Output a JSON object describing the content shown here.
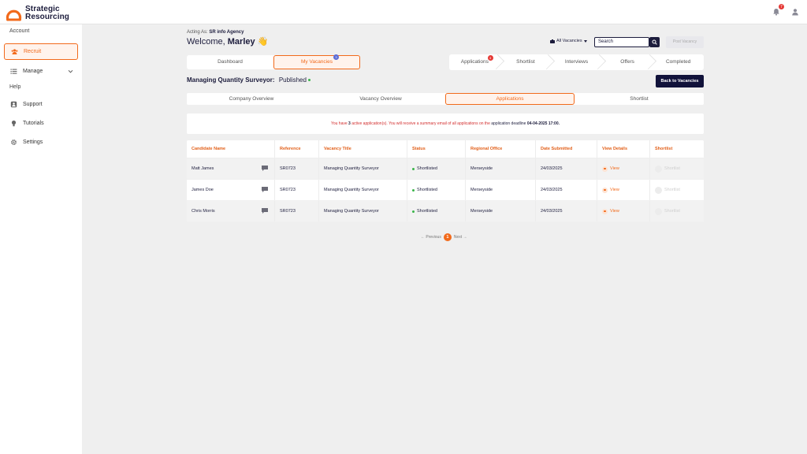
{
  "brand": {
    "line1": "Strategic",
    "line2": "Resourcing",
    "accent": "#f26a1b",
    "navy": "#1c1c3c"
  },
  "header": {
    "notification_count": "7",
    "icons": [
      "bell-icon",
      "user-icon"
    ]
  },
  "sidebar": {
    "section_account": "Account",
    "section_help": "Help",
    "items": [
      {
        "label": "Recruit",
        "icon": "recruit-icon",
        "active": true
      },
      {
        "label": "Manage",
        "icon": "list-icon"
      },
      {
        "label": "Support",
        "icon": "support-icon"
      },
      {
        "label": "Tutorials",
        "icon": "bulb-icon"
      },
      {
        "label": "Settings",
        "icon": "gear-icon"
      }
    ]
  },
  "page": {
    "acting_as_label": "Acting As:",
    "acting_as_value": "SR info Agency",
    "welcome_prefix": "Welcome,",
    "welcome_name": "Marley",
    "welcome_emoji": "👋",
    "all_vacancies": "All Vacancies",
    "search_placeholder": "Search",
    "post_vacancy": "Post Vacancy",
    "tabs": [
      {
        "label": "Dashboard"
      },
      {
        "label": "My Vacancies",
        "badge": "3"
      }
    ],
    "stages": [
      {
        "label": "Applications",
        "badge": "3"
      },
      {
        "label": "Shortlist"
      },
      {
        "label": "Interviews"
      },
      {
        "label": "Offers"
      },
      {
        "label": "Completed"
      }
    ],
    "vacancy_title": "Managing Quantity Surveyor:",
    "vacancy_status": "Published",
    "back_button": "Back to Vacancies",
    "subtabs": [
      "Company Overview",
      "Vacancy Overview",
      "Applications",
      "Shortlist"
    ],
    "notice": {
      "pre": "You have",
      "count": "3",
      "mid": "active application(s). You will receive a summary email of all applications on the",
      "deadline_label": "application deadline",
      "deadline_value": "04-04-2025 17:00."
    }
  },
  "table": {
    "headers": [
      "Candidate Name",
      "Reference",
      "Vacancy Title",
      "Status",
      "Regional Office",
      "Date Submitted",
      "View Details",
      "Shortlist"
    ],
    "rows": [
      {
        "name": "Matt James",
        "ref": "SR0723",
        "title": "Managing Quantity Surveyor",
        "status": "Shortlisted",
        "office": "Merseyside",
        "date": "24/03/2025",
        "view": "View",
        "shortlist": "Shortlist"
      },
      {
        "name": "James Doe",
        "ref": "SR0723",
        "title": "Managing Quantity Surveyor",
        "status": "Shortlisted",
        "office": "Merseyside",
        "date": "24/03/2025",
        "view": "View",
        "shortlist": "Shortlist"
      },
      {
        "name": "Chris Morris",
        "ref": "SR0723",
        "title": "Managing Quantity Surveyor",
        "status": "Shortlisted",
        "office": "Merseyside",
        "date": "24/03/2025",
        "view": "View",
        "shortlist": "Shortlist"
      }
    ]
  },
  "pagination": {
    "previous": "← Previous",
    "current": "1",
    "next": "Next →"
  }
}
